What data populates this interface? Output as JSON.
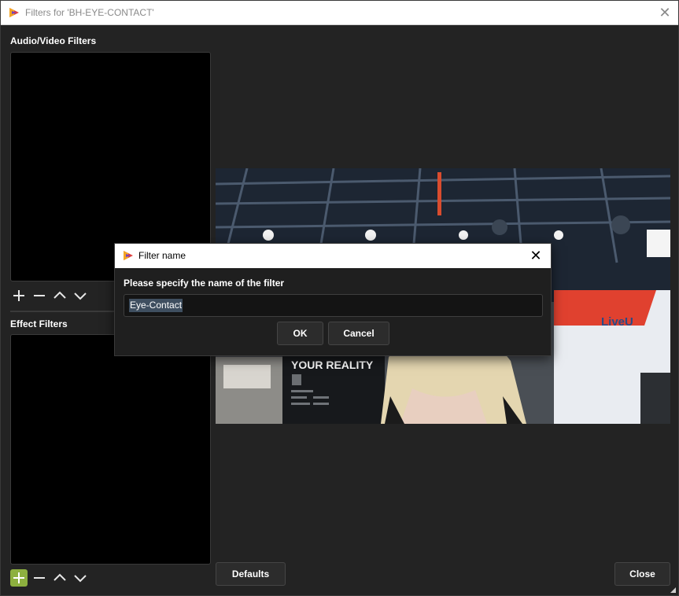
{
  "window": {
    "title": "Filters for 'BH-EYE-CONTACT'",
    "close_glyph": "✕",
    "icon": "app-logo-icon"
  },
  "sections": {
    "av_filters_label": "Audio/Video Filters",
    "effect_filters_label": "Effect Filters"
  },
  "toolbar_icons": [
    "add-icon",
    "remove-icon",
    "move-up-icon",
    "move-down-icon"
  ],
  "buttons": {
    "defaults": "Defaults",
    "close": "Close"
  },
  "dialog": {
    "title": "Filter name",
    "close_glyph": "✕",
    "prompt": "Please specify the name of the filter",
    "input_value": "Eye-Contact",
    "ok": "OK",
    "cancel": "Cancel"
  },
  "preview": {
    "booth_logo": "LiveU",
    "sign_text": "YOUR REALITY"
  },
  "colors": {
    "accent": "#8db03f",
    "background": "#232323",
    "list_bg": "#000000"
  }
}
